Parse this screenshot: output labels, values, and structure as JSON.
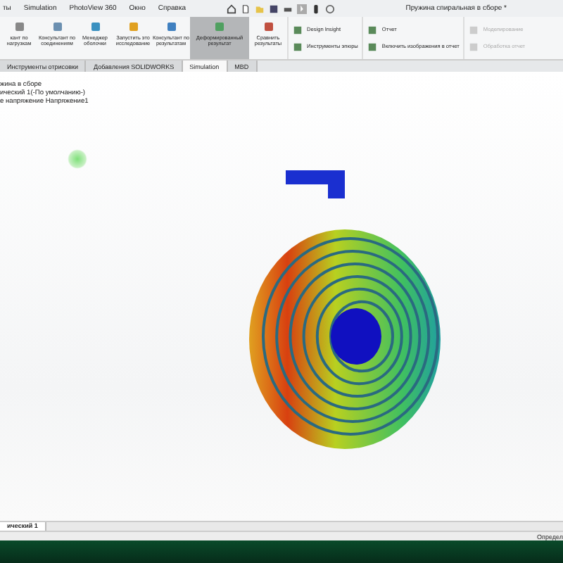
{
  "menu": [
    "ты",
    "Simulation",
    "PhotoView 360",
    "Окно",
    "Справка"
  ],
  "window": {
    "title": "Пружина спиральная в сборе *"
  },
  "ribbon": [
    {
      "label": "кант по нагрузкам",
      "selected": false,
      "disabled": false
    },
    {
      "label": "Консультант по соединениям",
      "selected": false,
      "disabled": false
    },
    {
      "label": "Менеджер оболочки",
      "selected": false,
      "disabled": false
    },
    {
      "label": "Запустить это исследование",
      "selected": false,
      "disabled": false
    },
    {
      "label": "Консультант по результатам",
      "selected": false,
      "disabled": false
    },
    {
      "label": "Деформированный результат",
      "selected": true,
      "disabled": false
    },
    {
      "label": "Сравнить результаты",
      "selected": false,
      "disabled": false
    }
  ],
  "ribbon_small": [
    {
      "label": "Design Insight",
      "disabled": false
    },
    {
      "label": "Инструменты эпюры",
      "disabled": false
    },
    {
      "label": "Отчет",
      "disabled": false
    },
    {
      "label": "Включить изображения в отчет",
      "disabled": false
    },
    {
      "label": "Моделирование",
      "disabled": true
    },
    {
      "label": "Обработка отчет",
      "disabled": true
    }
  ],
  "tabs": [
    {
      "label": "Инструменты отрисовки",
      "selected": false
    },
    {
      "label": "Добавления SOLIDWORKS",
      "selected": false
    },
    {
      "label": "Simulation",
      "selected": true
    },
    {
      "label": "MBD",
      "selected": false
    }
  ],
  "tree": [
    "жина в сборе",
    "ический 1(-По умолчанию-)",
    "е напряжение Напряжение1"
  ],
  "bottom_tab": "ический 1",
  "status_bar": "Определ"
}
